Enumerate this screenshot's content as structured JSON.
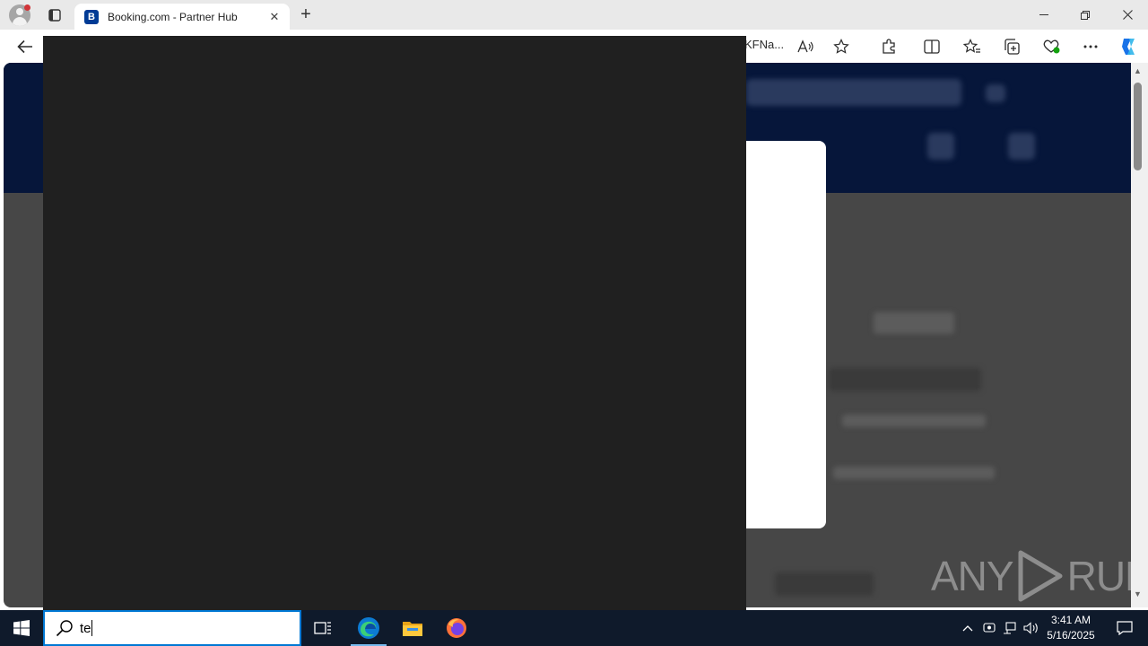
{
  "browser": {
    "tab": {
      "favicon_letter": "B",
      "title": "Booking.com - Partner Hub"
    },
    "address_fragment": "KFNa...",
    "window_controls": [
      "minimize",
      "restore",
      "close"
    ],
    "toolbar_icons": [
      "back-icon",
      "read-aloud-icon",
      "favorite-star-icon",
      "extensions-icon",
      "split-screen-icon",
      "favorites-icon",
      "collections-icon",
      "browser-essentials-icon",
      "more-icon",
      "copilot-icon"
    ]
  },
  "watermark": {
    "left": "ANY",
    "right": "RUN"
  },
  "search": {
    "query": "te"
  },
  "taskbar": {
    "apps": [
      "task-view-icon",
      "edge-icon",
      "file-explorer-icon",
      "firefox-icon"
    ],
    "clock": {
      "time": "3:41 AM",
      "date": "5/16/2025"
    }
  },
  "colors": {
    "accent": "#0078d4",
    "taskbar": "#0f1a2b",
    "panel": "#202020",
    "booking_blue": "#003b95"
  }
}
